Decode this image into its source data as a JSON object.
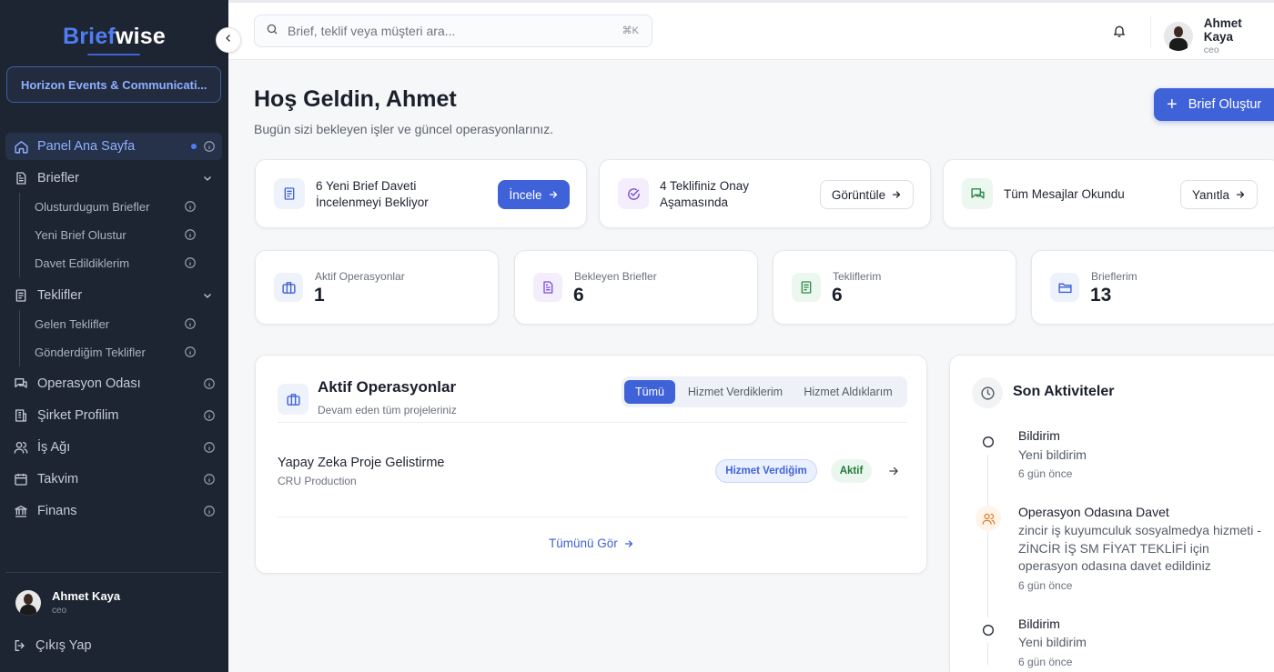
{
  "brand": {
    "part1": "Brief",
    "part2": "wise"
  },
  "organization": "Horizon Events & Communicati...",
  "sidebar": {
    "home": "Panel Ana Sayfa",
    "briefs": "Briefler",
    "briefs_sub": [
      "Olusturdugum Briefler",
      "Yeni Brief Olustur",
      "Davet Edildiklerim"
    ],
    "offers": "Teklifler",
    "offers_sub": [
      "Gelen Teklifler",
      "Gönderdiğim Teklifler"
    ],
    "ops_room": "Operasyon Odası",
    "company": "Şirket Profilim",
    "network": "İş Ağı",
    "calendar": "Takvim",
    "finance": "Finans",
    "logout": "Çıkış Yap"
  },
  "user": {
    "name": "Ahmet Kaya",
    "role": "ceo"
  },
  "search": {
    "placeholder": "Brief, teklif veya müşteri ara...",
    "shortcut": "⌘K"
  },
  "welcome": {
    "title": "Hoş Geldin, Ahmet",
    "subtitle": "Bugün sizi bekleyen işler ve güncel operasyonlarınız."
  },
  "create_button": "Brief Oluştur",
  "notices": [
    {
      "line1": "6 Yeni Brief Daveti",
      "line2": "İncelenmeyi Bekliyor",
      "button": "İncele"
    },
    {
      "line1": "4 Teklifiniz Onay",
      "line2": "Aşamasında",
      "button": "Görüntüle"
    },
    {
      "line1": "Tüm Mesajlar Okundu",
      "line2": "",
      "button": "Yanıtla"
    }
  ],
  "stats": [
    {
      "label": "Aktif Operasyonlar",
      "value": "1"
    },
    {
      "label": "Bekleyen Briefler",
      "value": "6"
    },
    {
      "label": "Tekliflerim",
      "value": "6"
    },
    {
      "label": "Brieflerim",
      "value": "13"
    }
  ],
  "operations": {
    "title": "Aktif Operasyonlar",
    "subtitle": "Devam eden tüm projeleriniz",
    "tabs": [
      "Tümü",
      "Hizmet Verdiklerim",
      "Hizmet Aldıklarım"
    ],
    "rows": [
      {
        "title": "Yapay Zeka Proje Gelistirme",
        "company": "CRU Production",
        "type": "Hizmet Verdiğim",
        "status": "Aktif"
      }
    ],
    "view_all": "Tümünü Gör"
  },
  "activity": {
    "title": "Son Aktiviteler",
    "items": [
      {
        "title": "Bildirim",
        "desc": "Yeni bildirim",
        "time": "6 gün önce"
      },
      {
        "title": "Operasyon Odasına Davet",
        "desc": "zincir iş kuyumculuk sosyalmedya hizmeti - ZİNCİR İŞ SM FİYAT TEKLİFİ için operasyon odasına davet edildiniz",
        "time": "6 gün önce"
      },
      {
        "title": "Bildirim",
        "desc": "Yeni bildirim",
        "time": "6 gün önce"
      }
    ]
  },
  "colors": {
    "primary": "#3f62d8",
    "sidebar": "#1e2532",
    "accent_text": "#8fb0ff"
  }
}
